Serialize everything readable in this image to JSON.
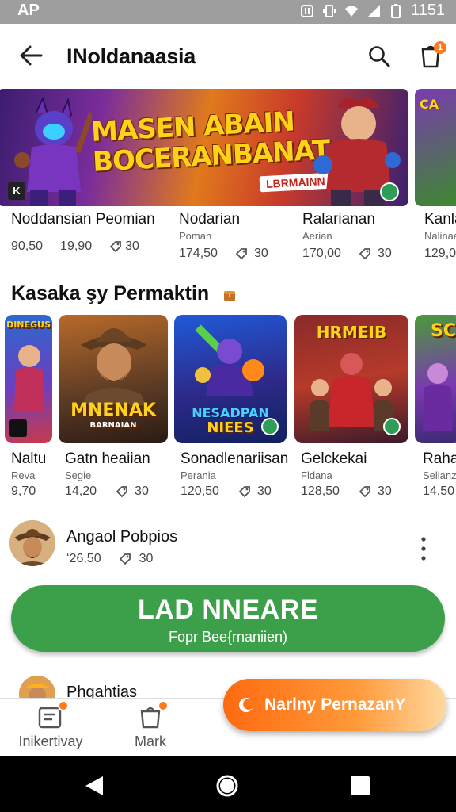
{
  "status_bar": {
    "left": "AP",
    "time": "1151"
  },
  "app_bar": {
    "title": "INoldanaasia",
    "cart_badge": "1"
  },
  "banner": {
    "headline_1": "MASEN ABAIN",
    "headline_2": "BOCERANBANAT",
    "tag": "LBRMAINN",
    "corner_label": "K",
    "side_label": "CA"
  },
  "featured": [
    {
      "name": "Noddansian Peomian",
      "sub": "",
      "price_a": "90,50",
      "price_b": "19,90",
      "count": "30"
    },
    {
      "name": "Nodarian",
      "sub": "Poman",
      "price_a": "174,50",
      "count": "30"
    },
    {
      "name": "Ralarianan",
      "sub": "Aerian",
      "price_a": "170,00",
      "count": "30"
    },
    {
      "name": "Kanla",
      "sub": "Nalinaa",
      "price_a": "129,0"
    }
  ],
  "section": {
    "title": "Kasaka şy Permaktin"
  },
  "tiles": [
    {
      "label": "DINEGUS",
      "name": "Naltu",
      "sub": "Reva",
      "price": "9,70"
    },
    {
      "label": "MNENAK",
      "label2": "BARNAIAN",
      "name": "Gatn heaiian",
      "sub": "Segie",
      "price": "14,20",
      "count": "30"
    },
    {
      "label": "NESADPAN",
      "label2": "NIEES",
      "name": "Sonadlenariisan",
      "sub": "Perania",
      "price": "120,50",
      "count": "30"
    },
    {
      "label": "HRMEIB",
      "name": "Gelckekai",
      "sub": "Fldana",
      "price": "128,50",
      "count": "30"
    },
    {
      "label": "SC",
      "name": "Raha",
      "sub": "Selianz",
      "price": "14,50"
    }
  ],
  "list_item": {
    "name": "Angaol Pobpios",
    "price": "ʻ26,50",
    "count": "30"
  },
  "primary_button": {
    "line1": "LAD NNEARE",
    "line2": "Fopr Bee{rnaniien)"
  },
  "partial_item": {
    "name": "Phgahtias"
  },
  "bottom_nav": [
    {
      "label": "Inikertivay",
      "icon": "list-icon"
    },
    {
      "label": "Mark",
      "icon": "bag-icon"
    }
  ],
  "fab": {
    "label": "Narlny PernazanY"
  },
  "colors": {
    "green": "#3c9f49",
    "orange": "#ff7a1a",
    "status_bar": "#9e9e9e"
  }
}
